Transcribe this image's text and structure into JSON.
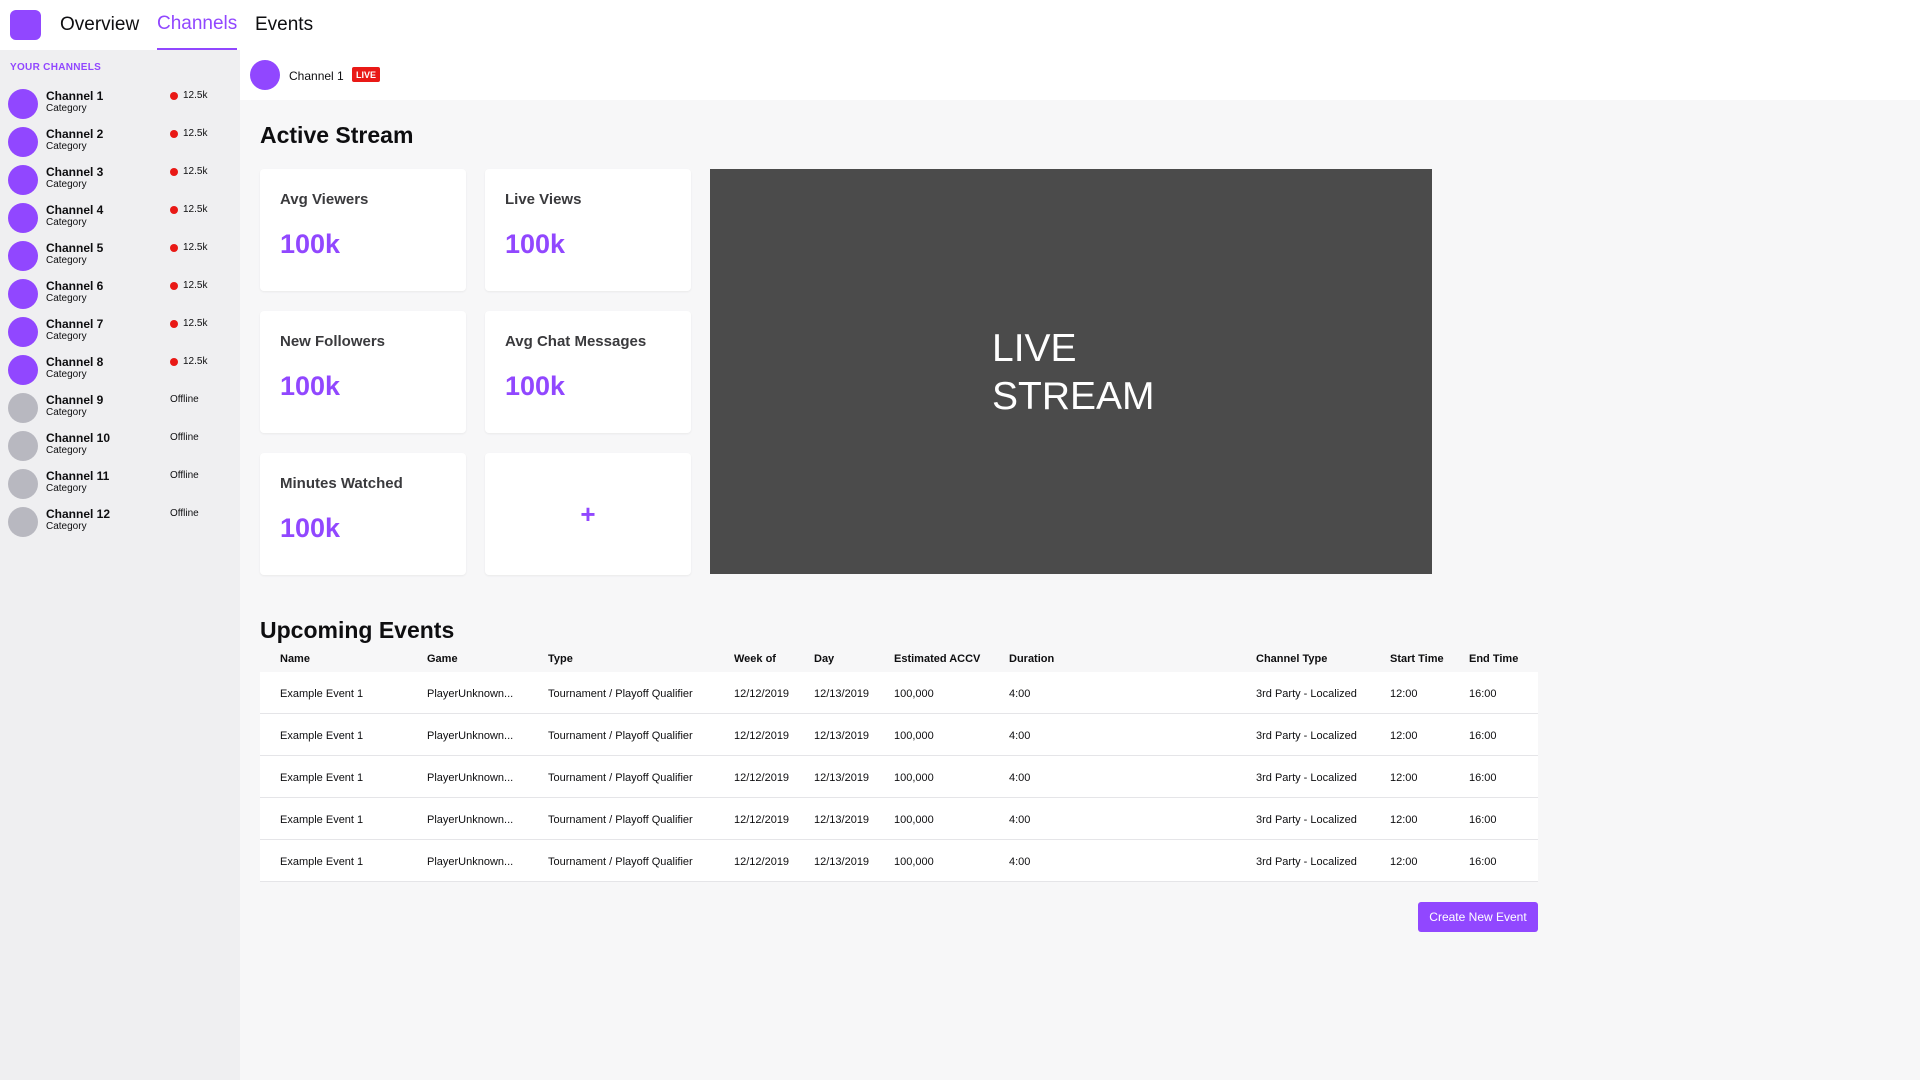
{
  "nav": {
    "tabs": [
      {
        "label": "Overview"
      },
      {
        "label": "Channels"
      },
      {
        "label": "Events"
      }
    ]
  },
  "sidebar": {
    "header": "YOUR CHANNELS",
    "channels": [
      {
        "name": "Channel 1",
        "category": "Category",
        "status": "12.5k",
        "live": true
      },
      {
        "name": "Channel 2",
        "category": "Category",
        "status": "12.5k",
        "live": true
      },
      {
        "name": "Channel 3",
        "category": "Category",
        "status": "12.5k",
        "live": true
      },
      {
        "name": "Channel 4",
        "category": "Category",
        "status": "12.5k",
        "live": true
      },
      {
        "name": "Channel 5",
        "category": "Category",
        "status": "12.5k",
        "live": true
      },
      {
        "name": "Channel 6",
        "category": "Category",
        "status": "12.5k",
        "live": true
      },
      {
        "name": "Channel 7",
        "category": "Category",
        "status": "12.5k",
        "live": true
      },
      {
        "name": "Channel 8",
        "category": "Category",
        "status": "12.5k",
        "live": true
      },
      {
        "name": "Channel 9",
        "category": "Category",
        "status": "Offline",
        "live": false
      },
      {
        "name": "Channel 10",
        "category": "Category",
        "status": "Offline",
        "live": false
      },
      {
        "name": "Channel 11",
        "category": "Category",
        "status": "Offline",
        "live": false
      },
      {
        "name": "Channel 12",
        "category": "Category",
        "status": "Offline",
        "live": false
      }
    ]
  },
  "channel_bar": {
    "name": "Channel 1",
    "badge": "LIVE"
  },
  "active_stream": {
    "title": "Active Stream",
    "stats": [
      {
        "label": "Avg Viewers",
        "value": "100k"
      },
      {
        "label": "Live Views",
        "value": "100k"
      },
      {
        "label": "New Followers",
        "value": "100k"
      },
      {
        "label": "Avg Chat Messages",
        "value": "100k"
      },
      {
        "label": "Minutes Watched",
        "value": "100k"
      }
    ],
    "add_label": "+",
    "video_line1": "LIVE",
    "video_line2": "STREAM"
  },
  "events": {
    "title": "Upcoming Events",
    "columns": [
      "Name",
      "Game",
      "Type",
      "Week of",
      "Day",
      "Estimated ACCV",
      "Duration",
      "Channel Type",
      "Start Time",
      "End Time"
    ],
    "rows": [
      [
        "Example Event 1",
        "PlayerUnknown...",
        "Tournament / Playoff Qualifier",
        "12/12/2019",
        "12/13/2019",
        "100,000",
        "4:00",
        "3rd Party - Localized",
        "12:00",
        "16:00"
      ],
      [
        "Example Event 1",
        "PlayerUnknown...",
        "Tournament / Playoff Qualifier",
        "12/12/2019",
        "12/13/2019",
        "100,000",
        "4:00",
        "3rd Party - Localized",
        "12:00",
        "16:00"
      ],
      [
        "Example Event 1",
        "PlayerUnknown...",
        "Tournament / Playoff Qualifier",
        "12/12/2019",
        "12/13/2019",
        "100,000",
        "4:00",
        "3rd Party - Localized",
        "12:00",
        "16:00"
      ],
      [
        "Example Event 1",
        "PlayerUnknown...",
        "Tournament / Playoff Qualifier",
        "12/12/2019",
        "12/13/2019",
        "100,000",
        "4:00",
        "3rd Party - Localized",
        "12:00",
        "16:00"
      ],
      [
        "Example Event 1",
        "PlayerUnknown...",
        "Tournament / Playoff Qualifier",
        "12/12/2019",
        "12/13/2019",
        "100,000",
        "4:00",
        "3rd Party - Localized",
        "12:00",
        "16:00"
      ]
    ],
    "create_button": "Create New Event"
  },
  "colors": {
    "accent": "#9147ff",
    "live_red": "#e91916",
    "sidebar_bg": "#efeff1",
    "video_bg": "#4b4b4b"
  }
}
